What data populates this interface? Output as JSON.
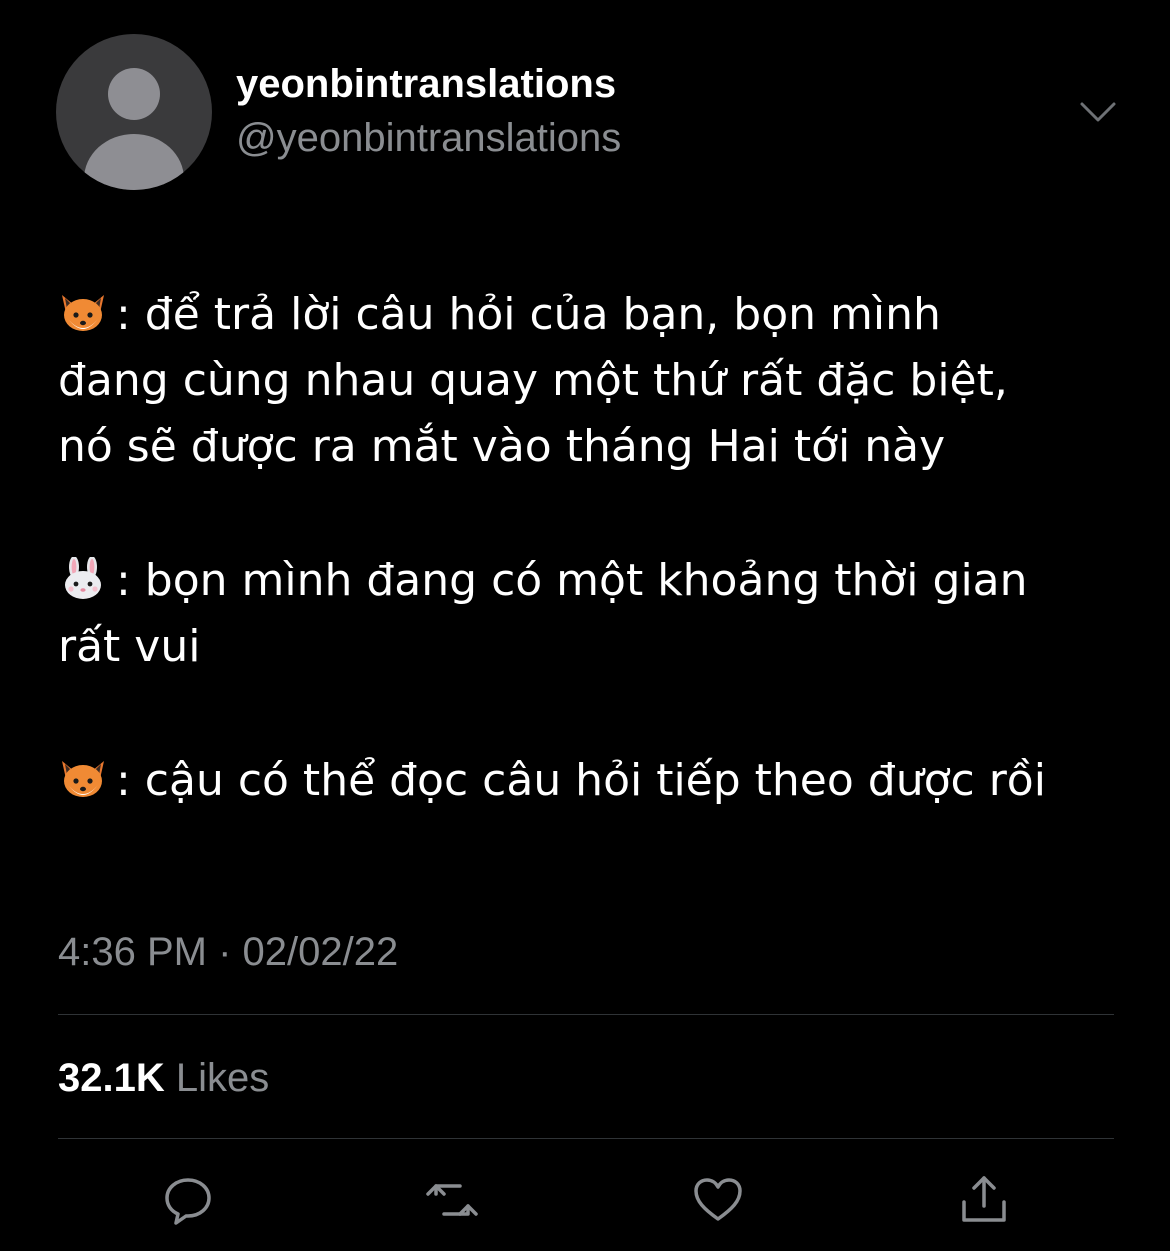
{
  "user": {
    "display_name": "yeonbintranslations",
    "handle": "@yeonbintranslations"
  },
  "tweet": {
    "paragraphs": [
      {
        "emoji": "fox-face-emoji",
        "lines": [
          ": để trả lời câu hỏi của bạn, bọn mình",
          "đang cùng nhau quay một thứ rất đặc biệt,",
          "nó sẽ được ra mắt vào tháng Hai tới này"
        ]
      },
      {
        "emoji": "rabbit-face-emoji",
        "lines": [
          ": bọn mình đang có một khoảng thời gian",
          "rất vui"
        ]
      },
      {
        "emoji": "fox-face-emoji",
        "lines": [
          ": cậu có thể đọc câu hỏi tiếp theo được rồi"
        ]
      }
    ],
    "timestamp": "4:36 PM · 02/02/22",
    "likes_count": "32.1K",
    "likes_label": "Likes"
  },
  "actions": [
    {
      "icon": "reply-icon"
    },
    {
      "icon": "retweet-icon"
    },
    {
      "icon": "like-icon"
    },
    {
      "icon": "share-icon"
    }
  ],
  "colors": {
    "background": "#000000",
    "text_primary": "#ffffff",
    "text_secondary": "#8a8d91",
    "divider": "#2f3336",
    "icon": "#8a8d91"
  }
}
